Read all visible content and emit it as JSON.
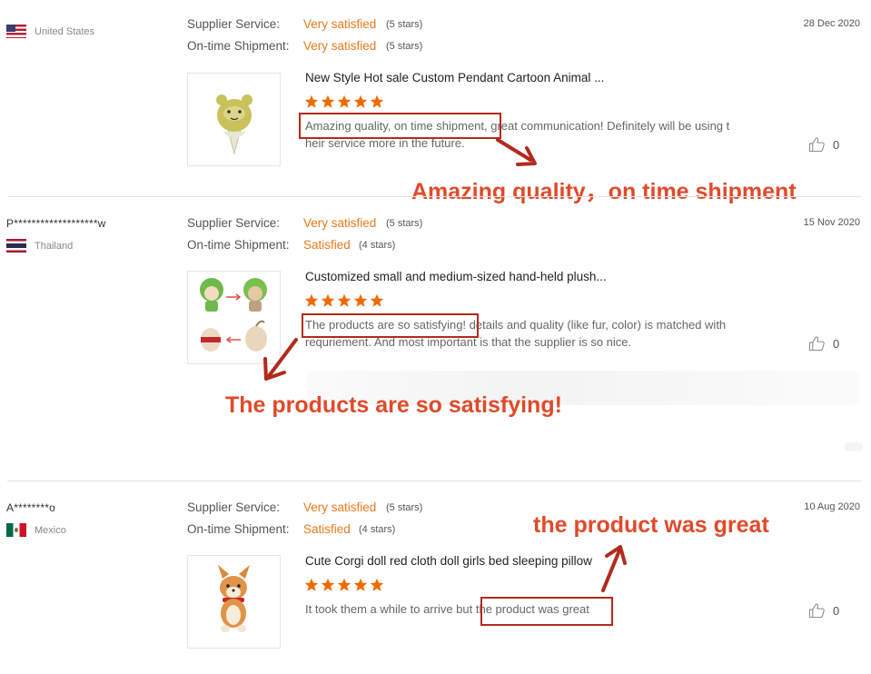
{
  "reviews": [
    {
      "buyer": "",
      "country": "United States",
      "flag_icon": "flag-us-icon",
      "supplier_service_label": "Supplier Service:",
      "supplier_service_value": "Very satisfied",
      "supplier_service_stars": "(5 stars)",
      "shipment_label": "On-time Shipment:",
      "shipment_value": "Very satisfied",
      "shipment_stars": "(5 stars)",
      "date": "28 Dec 2020",
      "product_title": "New Style Hot sale Custom Pendant Cartoon Animal ...",
      "rating": 5,
      "text_line1": "Amazing quality, on time shipment, great communication! Definitely will be using t",
      "text_line2": "heir service more in the future.",
      "likes": "0",
      "callout": "Amazing quality，on time shipment"
    },
    {
      "buyer": "P*******************w",
      "country": "Thailand",
      "flag_icon": "flag-th-icon",
      "supplier_service_label": "Supplier Service:",
      "supplier_service_value": "Very satisfied",
      "supplier_service_stars": "(5 stars)",
      "shipment_label": "On-time Shipment:",
      "shipment_value": "Satisfied",
      "shipment_stars": "(4 stars)",
      "date": "15 Nov 2020",
      "product_title": "Customized small and medium-sized hand-held plush...",
      "rating": 5,
      "text_line1": "The products are so satisfying! details and quality (like fur, color) is matched with",
      "text_line2": "requriement. And most important is that the supplier is so nice.",
      "likes": "0",
      "callout": "The products are so satisfying!"
    },
    {
      "buyer": "A********o",
      "country": "Mexico",
      "flag_icon": "flag-mx-icon",
      "supplier_service_label": "Supplier Service:",
      "supplier_service_value": "Very satisfied",
      "supplier_service_stars": "(5 stars)",
      "shipment_label": "On-time Shipment:",
      "shipment_value": "Satisfied",
      "shipment_stars": "(4 stars)",
      "date": "10 Aug 2020",
      "product_title": "Cute Corgi doll red cloth doll girls bed sleeping pillow",
      "rating": 5,
      "text_line1": "It took them a while to arrive but the product was great",
      "text_line2": "",
      "likes": "0",
      "callout": "the product was great"
    }
  ],
  "colors": {
    "accent_orange": "#e87a1b",
    "star_orange": "#f06a00",
    "highlight_box": "#b22a1e",
    "callout_red": "#e04a2a"
  }
}
